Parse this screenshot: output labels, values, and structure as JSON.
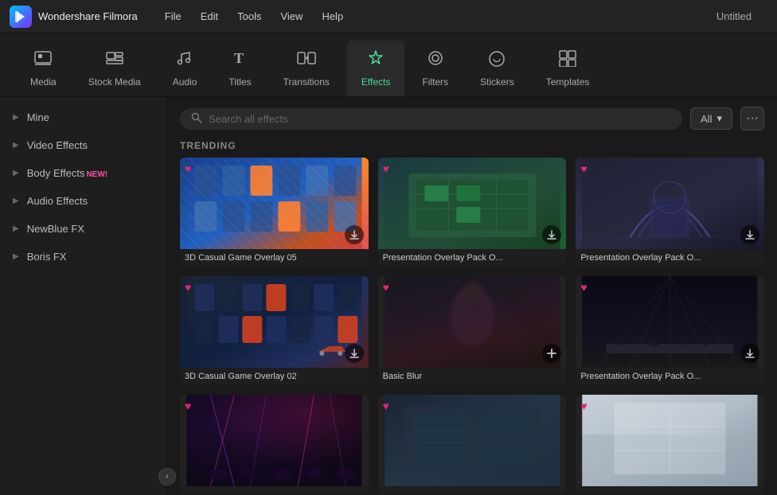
{
  "app": {
    "logo_letter": "F",
    "name": "Wondershare Filmora",
    "title": "Untitled"
  },
  "menu": {
    "items": [
      "File",
      "Edit",
      "Tools",
      "View",
      "Help"
    ]
  },
  "toolbar": {
    "tabs": [
      {
        "id": "media",
        "label": "Media",
        "icon": "⬜"
      },
      {
        "id": "stock_media",
        "label": "Stock Media",
        "icon": "🖼"
      },
      {
        "id": "audio",
        "label": "Audio",
        "icon": "♩"
      },
      {
        "id": "titles",
        "label": "Titles",
        "icon": "T"
      },
      {
        "id": "transitions",
        "label": "Transitions",
        "icon": "▶"
      },
      {
        "id": "effects",
        "label": "Effects",
        "icon": "✦",
        "active": true
      },
      {
        "id": "filters",
        "label": "Filters",
        "icon": "◎"
      },
      {
        "id": "stickers",
        "label": "Stickers",
        "icon": "🏷"
      },
      {
        "id": "templates",
        "label": "Templates",
        "icon": "⊞"
      }
    ]
  },
  "sidebar": {
    "items": [
      {
        "id": "mine",
        "label": "Mine"
      },
      {
        "id": "video_effects",
        "label": "Video Effects"
      },
      {
        "id": "body_effects",
        "label": "Body Effects",
        "badge": "NEW!"
      },
      {
        "id": "audio_effects",
        "label": "Audio Effects"
      },
      {
        "id": "newblue_fx",
        "label": "NewBlue FX"
      },
      {
        "id": "boris_fx",
        "label": "Boris FX"
      }
    ],
    "collapse_label": "‹"
  },
  "search": {
    "placeholder": "Search all effects",
    "filter_label": "All",
    "filter_chevron": "▾",
    "more_icon": "···"
  },
  "section": {
    "trending_label": "TRENDING"
  },
  "effects": {
    "rows": [
      [
        {
          "id": "game05",
          "label": "3D Casual Game Overlay 05",
          "has_heart": true,
          "has_download": true
        },
        {
          "id": "pres01",
          "label": "Presentation Overlay Pack O...",
          "has_heart": true,
          "has_download": true
        },
        {
          "id": "pres02",
          "label": "Presentation Overlay Pack O...",
          "has_heart": true,
          "has_download": true
        }
      ],
      [
        {
          "id": "game02",
          "label": "3D Casual Game Overlay 02",
          "has_heart": true,
          "has_download": true
        },
        {
          "id": "blur",
          "label": "Basic Blur",
          "has_heart": true,
          "has_add": true
        },
        {
          "id": "concert",
          "label": "Presentation Overlay Pack O...",
          "has_heart": true,
          "has_download": true
        }
      ],
      [
        {
          "id": "stage",
          "label": "",
          "has_heart": true
        },
        {
          "id": "pres03",
          "label": "",
          "has_heart": true
        },
        {
          "id": "pres04",
          "label": "",
          "has_heart": true
        }
      ]
    ]
  }
}
